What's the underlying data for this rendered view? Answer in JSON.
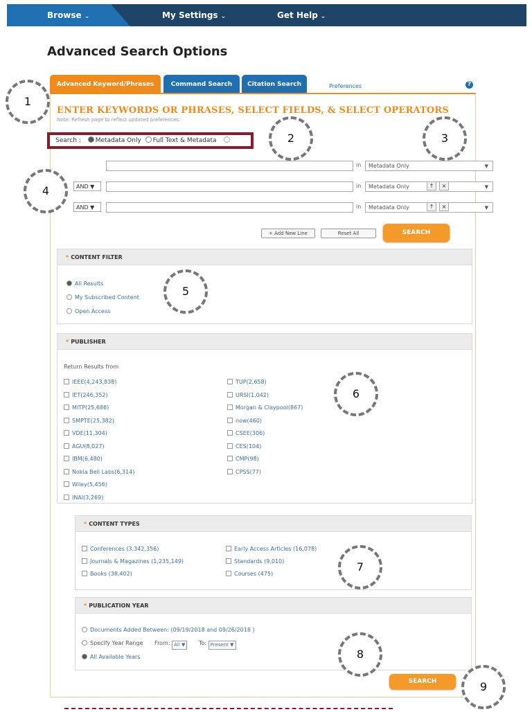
{
  "nav": {
    "items": [
      {
        "label": "Browse"
      },
      {
        "label": "My Settings"
      },
      {
        "label": "Get Help"
      }
    ],
    "chevron": "chevron-down-icon"
  },
  "page_title": "Advanced Search Options",
  "tabs": [
    {
      "label": "Advanced Keyword/Phrases"
    },
    {
      "label": "Command Search"
    },
    {
      "label": "Citation Search"
    }
  ],
  "preferences_link": "Preferences",
  "help_icon": "?",
  "form": {
    "heading": "ENTER KEYWORDS OR PHRASES, SELECT FIELDS, & SELECT OPERATORS",
    "subheading": "Note: Refresh page to reflect updated preferences.",
    "search_scope": {
      "label": "Search :",
      "options": [
        {
          "label": "Metadata Only",
          "selected": true
        },
        {
          "label": "Full Text & Metadata",
          "selected": false
        }
      ]
    },
    "in_label": "in",
    "rows": [
      {
        "operator": "",
        "value": "",
        "field": "Metadata Only"
      },
      {
        "operator": "AND",
        "value": "",
        "field": "Metadata Only"
      },
      {
        "operator": "AND",
        "value": "",
        "field": "Metadata Only"
      }
    ],
    "add_new_line": "+ Add New Line",
    "reset_all": "Reset All",
    "search_button": "SEARCH"
  },
  "content_filter": {
    "title": "CONTENT FILTER",
    "options": [
      {
        "label": "All Results",
        "selected": true
      },
      {
        "label": "My Subscribed Content",
        "selected": false
      },
      {
        "label": "Open Access",
        "selected": false
      }
    ]
  },
  "publisher": {
    "title": "PUBLISHER",
    "intro": "Return Results from",
    "col1": [
      "IEEE(4,243,838)",
      "IET(246,352)",
      "MITP(25,686)",
      "SMPTE(25,382)",
      "VDE(11,304)",
      "AGU(8,027)",
      "IBM(6,480)",
      "Nokia Bell Labs(6,314)",
      "Wiley(5,456)",
      "INAI(3,269)"
    ],
    "col2": [
      "TUP(2,658)",
      "URSI(1,042)",
      "Morgan & Claypool(867)",
      "now(460)",
      "CSEE(306)",
      "CES(104)",
      "CMP(98)",
      "CPSS(77)"
    ]
  },
  "content_types": {
    "title": "CONTENT TYPES",
    "col1": [
      "Conferences (3,342,356)",
      "Journals & Magazines (1,235,149)",
      "Books (38,402)"
    ],
    "col2": [
      "Early Access Articles (16,078)",
      "Standards (9,010)",
      "Courses (475)"
    ]
  },
  "publication_year": {
    "title": "PUBLICATION YEAR",
    "documents_added": "Documents Added Between: (09/19/2018 and 09/26/2018 )",
    "specify_range": "Specify Year Range",
    "from_label": "From:",
    "from_value": "All",
    "to_label": "To:",
    "to_value": "Present",
    "all_years": "All Available Years"
  },
  "bottom_search": "SEARCH",
  "callouts": [
    "1",
    "2",
    "3",
    "4",
    "5",
    "6",
    "7",
    "8",
    "9"
  ],
  "colors": {
    "nav_bg": "#1d4466",
    "tab_blue": "#1f6fb1",
    "accent_orange": "#ef8a1c",
    "scope_border": "#8b1a2b"
  }
}
